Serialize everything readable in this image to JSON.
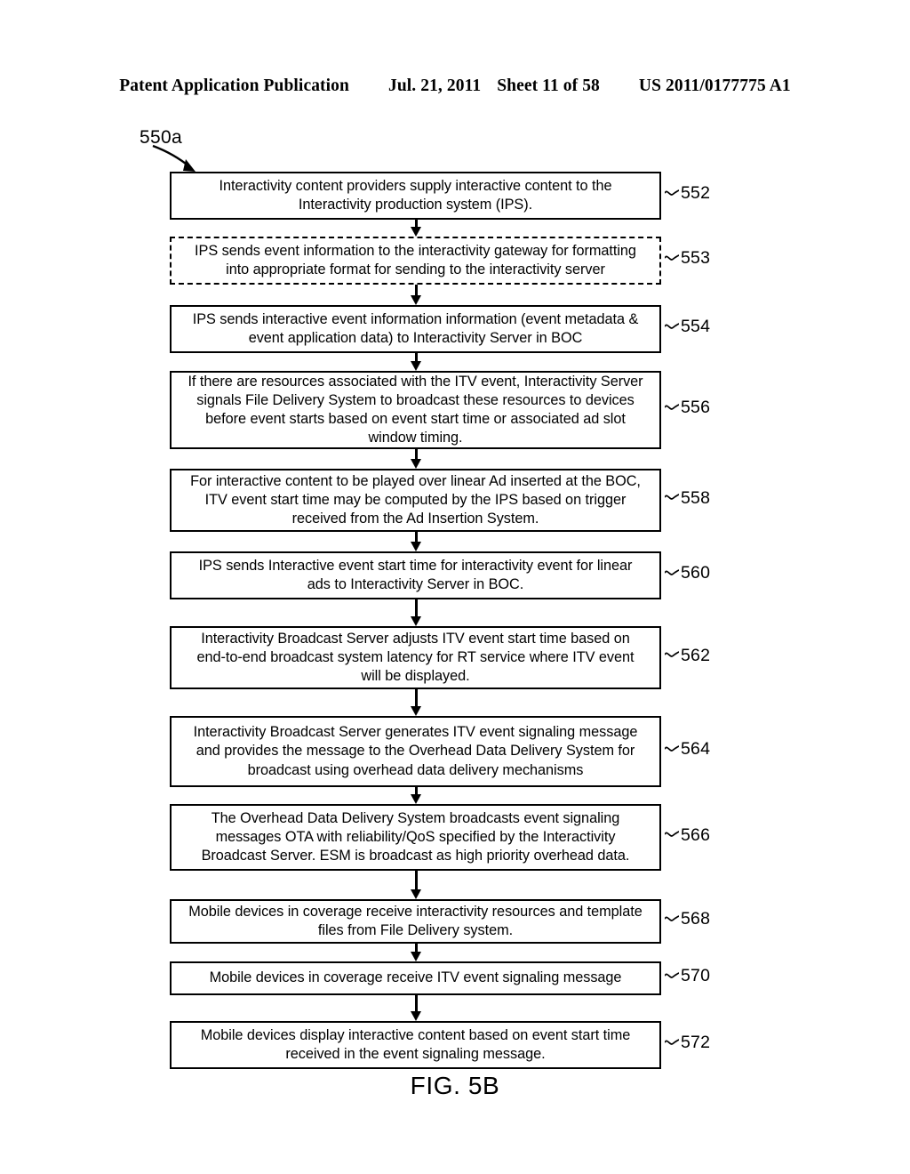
{
  "header": {
    "publication": "Patent Application Publication",
    "date": "Jul. 21, 2011",
    "sheet": "Sheet 11 of 58",
    "patent_number": "US 2011/0177775 A1"
  },
  "figure": {
    "caption": "FIG. 5B",
    "diagram_ref": "550a"
  },
  "flow": {
    "nodes": [
      {
        "ref": "552",
        "style": "solid",
        "text": "Interactivity content providers supply interactive content to the\nInteractivity production system (IPS)."
      },
      {
        "ref": "553",
        "style": "dashed",
        "text": "IPS sends event information to the interactivity gateway for formatting\ninto appropriate format for sending to the interactivity server"
      },
      {
        "ref": "554",
        "style": "solid",
        "text": "IPS sends interactive event information information (event metadata &\nevent application data) to Interactivity Server in BOC"
      },
      {
        "ref": "556",
        "style": "solid",
        "text": "If there are resources associated with the ITV event, Interactivity Server\nsignals File Delivery System to broadcast these resources to devices\nbefore event starts based on event start time or associated ad slot\nwindow timing."
      },
      {
        "ref": "558",
        "style": "solid",
        "text": "For interactive content to be played over linear Ad inserted at the BOC,\nITV event start time may be computed by the IPS based on trigger\nreceived from the Ad Insertion System."
      },
      {
        "ref": "560",
        "style": "solid",
        "text": "IPS sends Interactive event start time for interactivity event for linear\nads to Interactivity Server in BOC."
      },
      {
        "ref": "562",
        "style": "solid",
        "text": "Interactivity Broadcast Server adjusts ITV event start time based on\nend-to-end broadcast system latency for RT service where ITV event\nwill be displayed."
      },
      {
        "ref": "564",
        "style": "solid",
        "text": "Interactivity Broadcast Server generates ITV event signaling message\nand provides the message to the Overhead Data Delivery System for\nbroadcast using overhead data delivery mechanisms"
      },
      {
        "ref": "566",
        "style": "solid",
        "text": "The Overhead Data Delivery System broadcasts event signaling\nmessages OTA with reliability/QoS specified by the Interactivity\nBroadcast Server.  ESM is broadcast as high priority overhead data."
      },
      {
        "ref": "568",
        "style": "solid",
        "text": "Mobile devices in coverage receive interactivity resources and template\nfiles from File Delivery system."
      },
      {
        "ref": "570",
        "style": "solid",
        "text": "Mobile devices in coverage receive ITV event signaling message"
      },
      {
        "ref": "572",
        "style": "solid",
        "text": "Mobile devices display interactive content based on event start time\nreceived in the event signaling message."
      }
    ]
  }
}
